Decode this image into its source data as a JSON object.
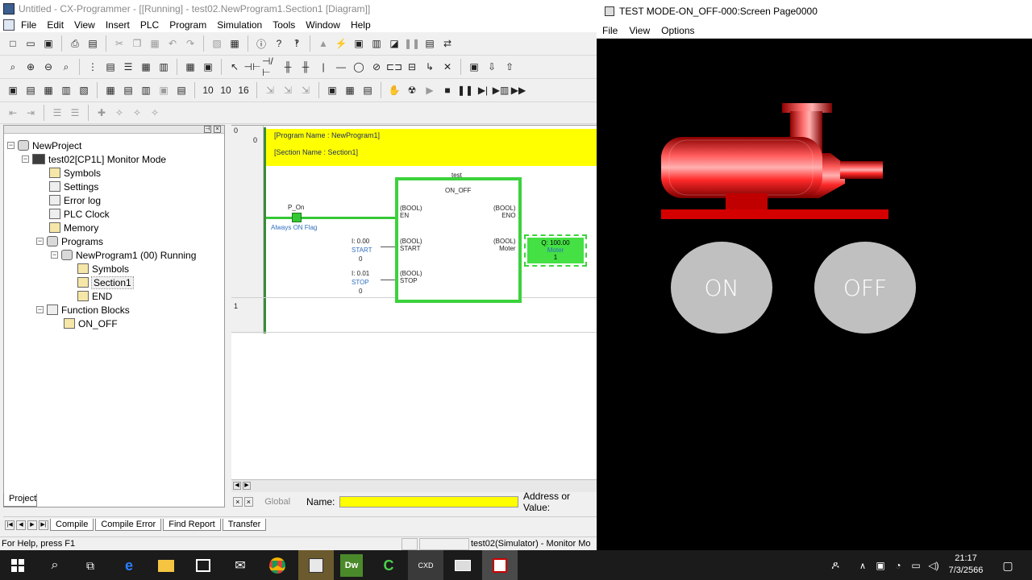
{
  "main_window": {
    "title": "Untitled - CX-Programmer - [[Running] - test02.NewProgram1.Section1 [Diagram]]",
    "menu": [
      "File",
      "Edit",
      "View",
      "Insert",
      "PLC",
      "Program",
      "Simulation",
      "Tools",
      "Window",
      "Help"
    ]
  },
  "project_tree": {
    "items": [
      {
        "label": "NewProject"
      },
      {
        "label": "test02[CP1L] Monitor Mode"
      },
      {
        "label": "Symbols"
      },
      {
        "label": "Settings"
      },
      {
        "label": "Error log"
      },
      {
        "label": "PLC Clock"
      },
      {
        "label": "Memory"
      },
      {
        "label": "Programs"
      },
      {
        "label": "NewProgram1 (00) Running"
      },
      {
        "label": "Symbols"
      },
      {
        "label": "Section1"
      },
      {
        "label": "END"
      },
      {
        "label": "Function Blocks"
      },
      {
        "label": "ON_OFF"
      }
    ],
    "tab_label": "Project"
  },
  "diagram": {
    "rung0_number": "0",
    "rung0_step": "0",
    "rung1_number": "1",
    "program_name": "[Program Name : NewProgram1]",
    "section_name": "[Section Name : Section1]",
    "fb_instance": "test",
    "fb_name": "ON_OFF",
    "en_label": "(BOOL)\nEN",
    "eno_label": "(BOOL)\nENO",
    "start_label": "(BOOL)\nSTART",
    "stop_label": "(BOOL)\nSTOP",
    "moter_label": "(BOOL)\nMoter",
    "p_on": "P_On",
    "always_on": "Always ON Flag",
    "start_addr": "I: 0.00",
    "start_name": "START",
    "start_val": "0",
    "stop_addr": "I: 0.01",
    "stop_name": "STOP",
    "stop_val": "0",
    "out_addr": "Q: 100.00",
    "out_name": "Moter",
    "out_val": "1"
  },
  "namebar": {
    "global": "Global",
    "name_label": "Name:",
    "addr_label": "Address or Value:"
  },
  "output_tabs": [
    "Compile",
    "Compile Error",
    "Find Report",
    "Transfer"
  ],
  "status": {
    "help": "For Help, press F1",
    "mode": "test02(Simulator) - Monitor Mo"
  },
  "sim_window": {
    "title": "TEST MODE-ON_OFF-000:Screen Page0000",
    "menu": [
      "File",
      "View",
      "Options"
    ],
    "on_button": "ON",
    "off_button": "OFF",
    "motor_color": "#ff1a1a"
  },
  "taskbar": {
    "time": "21:17",
    "date": "7/3/2566"
  }
}
